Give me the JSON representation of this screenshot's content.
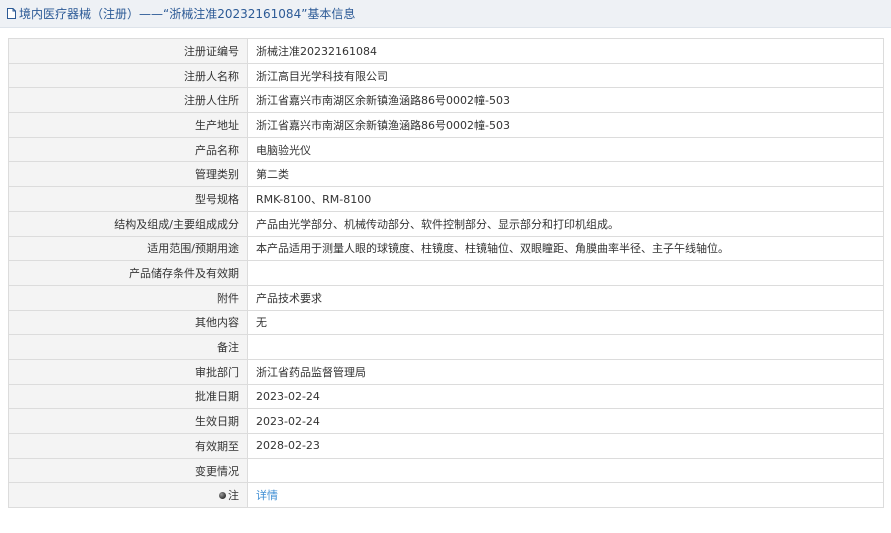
{
  "header": {
    "title": "境内医疗器械（注册）——“浙械注准20232161084”基本信息"
  },
  "rows": [
    {
      "label": "注册证编号",
      "value": "浙械注准20232161084"
    },
    {
      "label": "注册人名称",
      "value": "浙江高目光学科技有限公司"
    },
    {
      "label": "注册人住所",
      "value": "浙江省嘉兴市南湖区余新镇渔涵路86号0002幢-503"
    },
    {
      "label": "生产地址",
      "value": "浙江省嘉兴市南湖区余新镇渔涵路86号0002幢-503"
    },
    {
      "label": "产品名称",
      "value": "电脑验光仪"
    },
    {
      "label": "管理类别",
      "value": "第二类"
    },
    {
      "label": "型号规格",
      "value": "RMK-8100、RM-8100"
    },
    {
      "label": "结构及组成/主要组成成分",
      "value": "产品由光学部分、机械传动部分、软件控制部分、显示部分和打印机组成。"
    },
    {
      "label": "适用范围/预期用途",
      "value": "本产品适用于测量人眼的球镜度、柱镜度、柱镜轴位、双眼瞳距、角膜曲率半径、主子午线轴位。"
    },
    {
      "label": "产品储存条件及有效期",
      "value": ""
    },
    {
      "label": "附件",
      "value": "产品技术要求"
    },
    {
      "label": "其他内容",
      "value": "无"
    },
    {
      "label": "备注",
      "value": ""
    },
    {
      "label": "审批部门",
      "value": "浙江省药品监督管理局"
    },
    {
      "label": "批准日期",
      "value": "2023-02-24"
    },
    {
      "label": "生效日期",
      "value": "2023-02-24"
    },
    {
      "label": "有效期至",
      "value": "2028-02-23"
    },
    {
      "label": "变更情况",
      "value": ""
    }
  ],
  "note_row": {
    "label": "注",
    "link": "详情"
  }
}
